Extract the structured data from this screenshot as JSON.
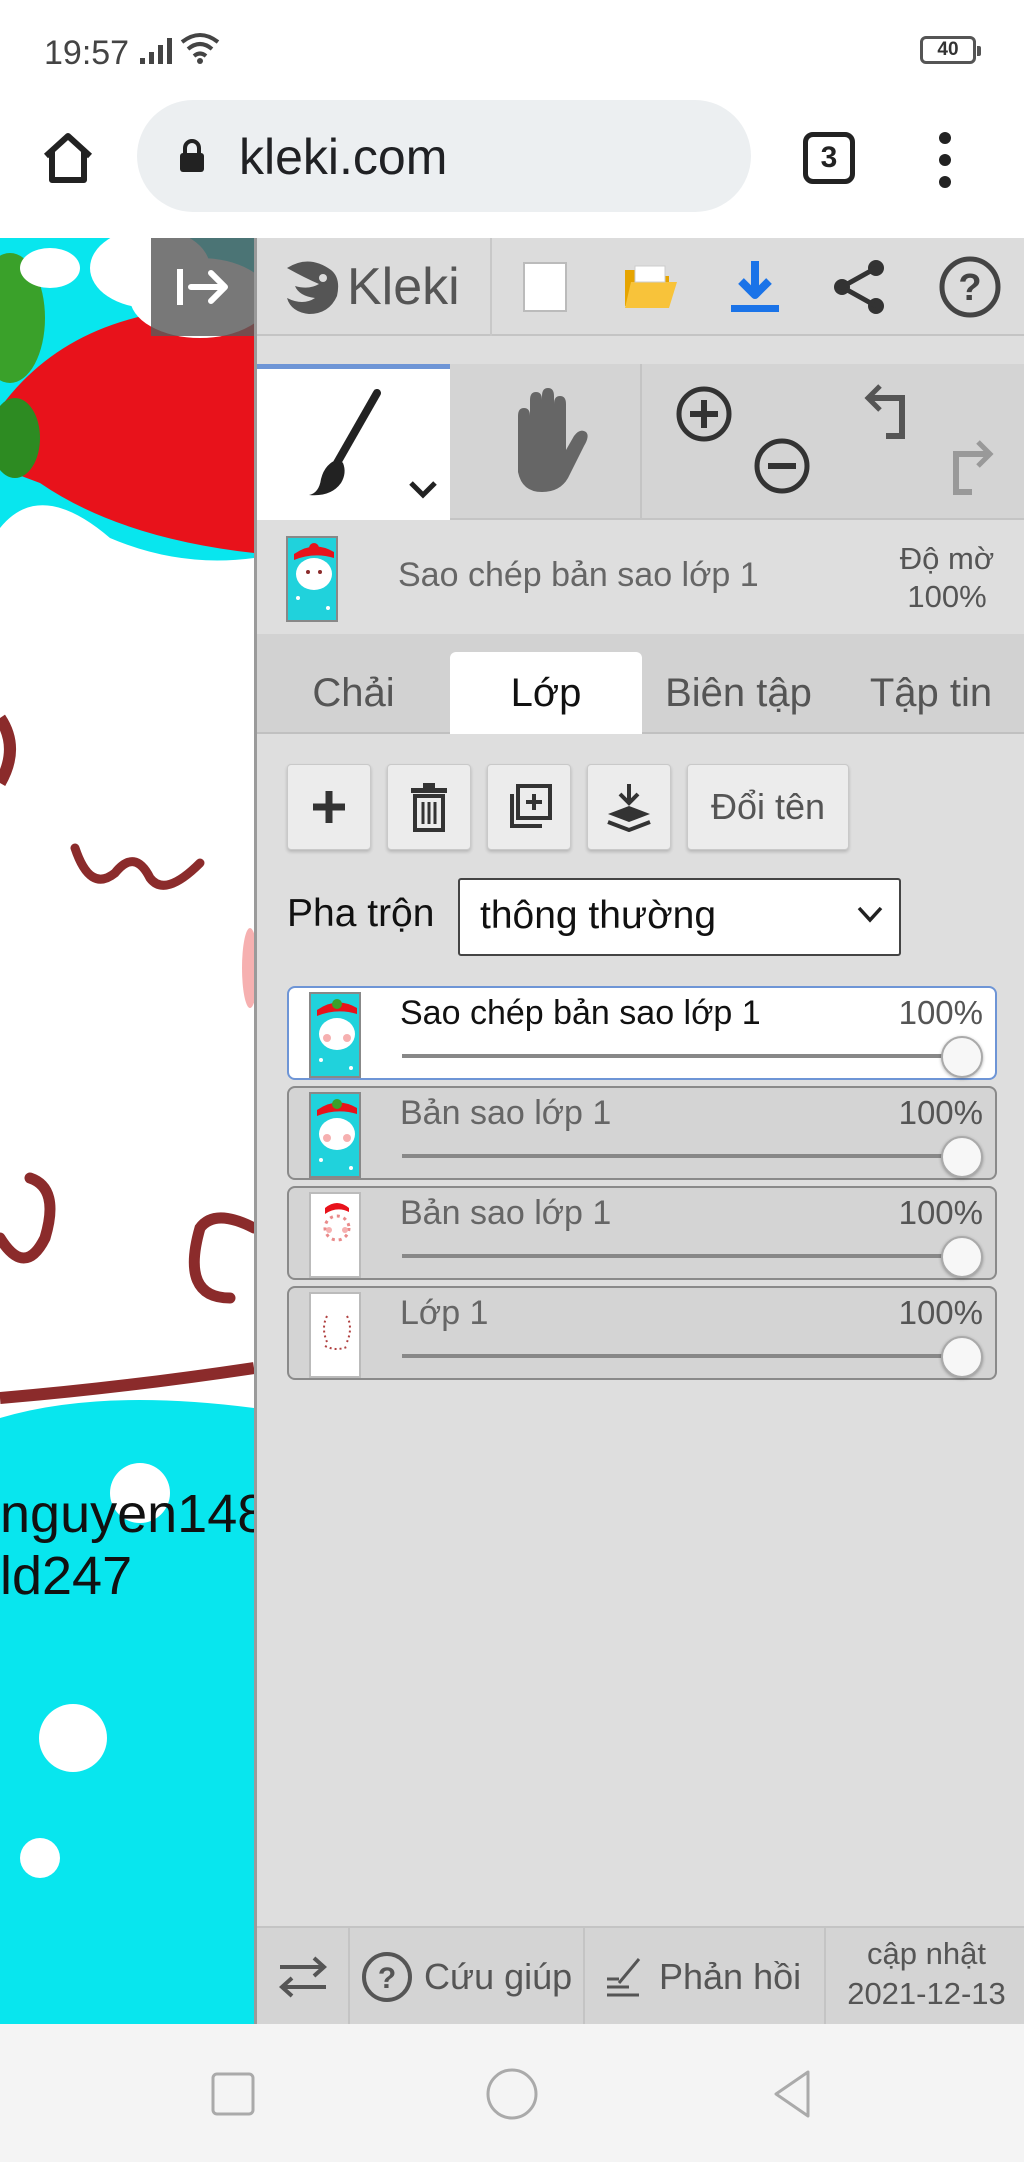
{
  "status_bar": {
    "time": "19:57",
    "battery": "40"
  },
  "browser": {
    "url": "kleki.com",
    "tab_count": "3"
  },
  "canvas": {
    "text_line1": "nguyen148",
    "text_line2": "ld247"
  },
  "kleki": {
    "logo_text": "Kleki",
    "current_layer": {
      "name": "Sao chép bản sao lớp 1",
      "opacity_label": "Độ mờ",
      "opacity_value": "100%"
    },
    "tabs": [
      {
        "label": "Chải",
        "active": false
      },
      {
        "label": "Lớp",
        "active": true
      },
      {
        "label": "Biên tập",
        "active": false
      },
      {
        "label": "Tập tin",
        "active": false
      }
    ],
    "actions": {
      "rename_label": "Đổi tên"
    },
    "blend": {
      "label": "Pha trộn",
      "value": "thông thường"
    },
    "layers": [
      {
        "name": "Sao chép bản sao lớp 1",
        "opacity": "100%",
        "opacity_value": 1.0,
        "active": true
      },
      {
        "name": "Bản sao lớp 1",
        "opacity": "100%",
        "opacity_value": 1.0,
        "active": false
      },
      {
        "name": "Bản sao lớp 1",
        "opacity": "100%",
        "opacity_value": 1.0,
        "active": false
      },
      {
        "name": "Lớp 1",
        "opacity": "100%",
        "opacity_value": 1.0,
        "active": false
      }
    ],
    "bottom": {
      "help_label": "Cứu giúp",
      "feedback_label": "Phản hồi",
      "update_label": "cập nhật",
      "update_date": "2021-12-13"
    }
  },
  "colors": {
    "accent": "#6e95d6",
    "canvas_bg": "#08e6ee",
    "hat_red": "#e8121b",
    "save_blue": "#1a73e8"
  }
}
